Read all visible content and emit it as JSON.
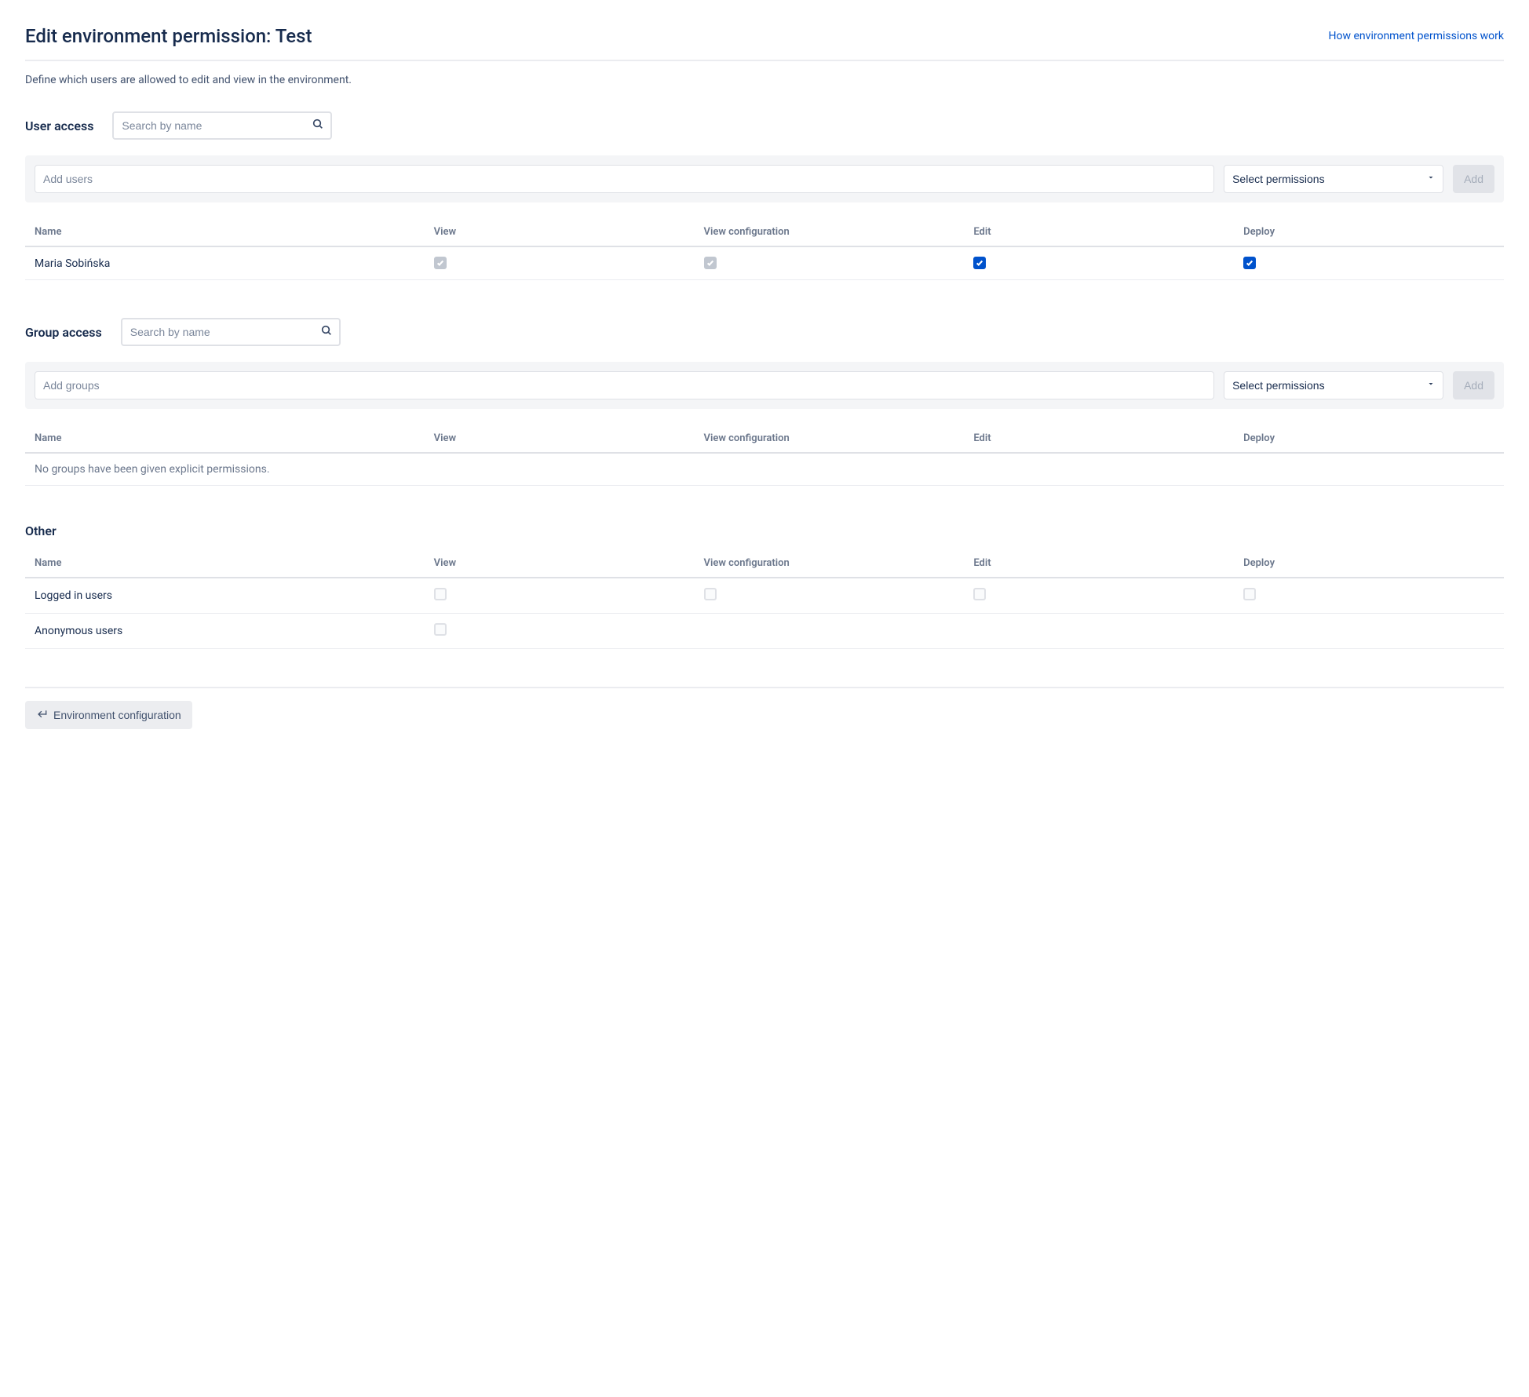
{
  "header": {
    "title": "Edit environment permission: Test",
    "help_link": "How environment permissions work"
  },
  "description": "Define which users are allowed to edit and view in the environment.",
  "columns": {
    "name": "Name",
    "view": "View",
    "view_config": "View configuration",
    "edit": "Edit",
    "deploy": "Deploy"
  },
  "user_access": {
    "title": "User access",
    "search_placeholder": "Search by name",
    "add_placeholder": "Add users",
    "select_label": "Select permissions",
    "add_button": "Add",
    "rows": [
      {
        "name": "Maria Sobińska",
        "view": "checked-disabled",
        "view_config": "checked-disabled",
        "edit": "checked",
        "deploy": "checked"
      }
    ]
  },
  "group_access": {
    "title": "Group access",
    "search_placeholder": "Search by name",
    "add_placeholder": "Add groups",
    "select_label": "Select permissions",
    "add_button": "Add",
    "empty_text": "No groups have been given explicit permissions."
  },
  "other": {
    "title": "Other",
    "rows": [
      {
        "name": "Logged in users",
        "view": "unchecked",
        "view_config": "unchecked",
        "edit": "unchecked",
        "deploy": "unchecked"
      },
      {
        "name": "Anonymous users",
        "view": "unchecked",
        "view_config": null,
        "edit": null,
        "deploy": null
      }
    ]
  },
  "footer": {
    "back_button": "Environment configuration"
  }
}
